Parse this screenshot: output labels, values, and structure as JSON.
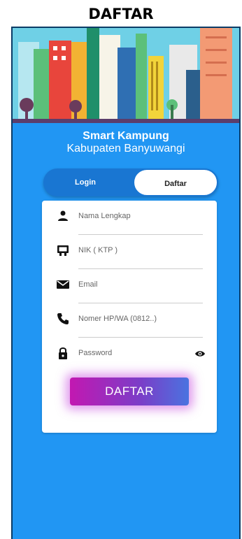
{
  "caption": "DAFTAR",
  "app": {
    "title": "Smart Kampung",
    "subtitle": "Kabupaten Banyuwangi"
  },
  "tabs": {
    "login": "Login",
    "daftar": "Daftar",
    "active": "Daftar"
  },
  "form": {
    "fields": [
      {
        "placeholder": "Nama Lengkap",
        "icon": "person-icon"
      },
      {
        "placeholder": "NIK ( KTP )",
        "icon": "id-card-icon"
      },
      {
        "placeholder": "Email",
        "icon": "email-icon"
      },
      {
        "placeholder": "Nomer HP/WA (0812..)",
        "icon": "phone-icon"
      },
      {
        "placeholder": "Password",
        "icon": "lock-icon"
      }
    ],
    "password_toggle_icon": "eye-icon",
    "submit_label": "DAFTAR"
  },
  "colors": {
    "background": "#2196F3",
    "toggle": "#1976D2",
    "button_gradient_start": "#c218b1",
    "button_gradient_end": "#4a73e0"
  }
}
